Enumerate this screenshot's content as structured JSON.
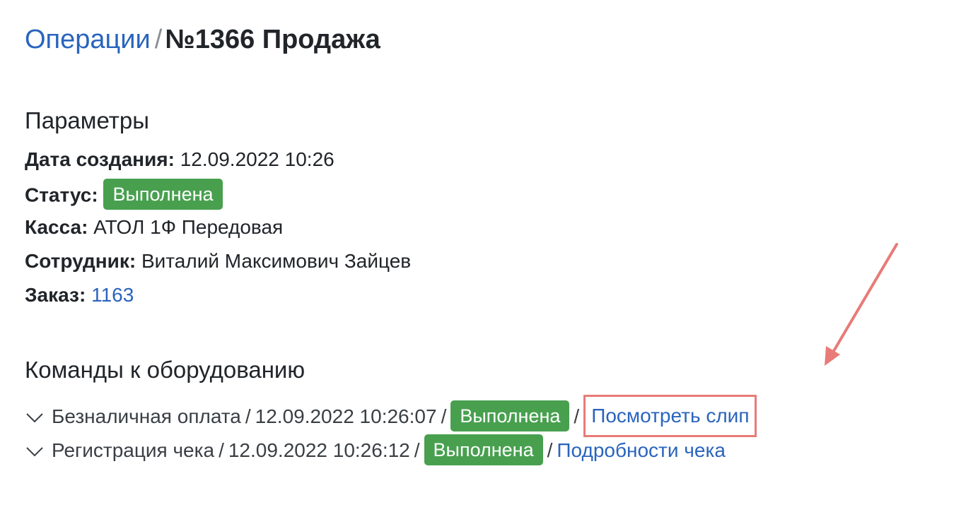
{
  "breadcrumb": {
    "parent": "Операции",
    "separator": "/",
    "current": "№1366 Продажа"
  },
  "params": {
    "title": "Параметры",
    "created_label": "Дата создания:",
    "created_value": "12.09.2022 10:26",
    "status_label": "Статус:",
    "status_value": "Выполнена",
    "kassa_label": "Касса:",
    "kassa_value": "АТОЛ 1Ф Передовая",
    "employee_label": "Сотрудник:",
    "employee_value": "Виталий Максимович Зайцев",
    "order_label": "Заказ:",
    "order_value": "1163"
  },
  "commands": {
    "title": "Команды к оборудованию",
    "items": [
      {
        "name": "Безналичная оплата",
        "datetime": "12.09.2022 10:26:07",
        "status": "Выполнена",
        "link": "Посмотреть слип"
      },
      {
        "name": "Регистрация чека",
        "datetime": "12.09.2022 10:26:12",
        "status": "Выполнена",
        "link": "Подробности чека"
      }
    ],
    "separator": "/"
  },
  "colors": {
    "link": "#2a64bd",
    "success_badge": "#48a04f",
    "annotation": "#e87b78"
  },
  "icons": {
    "expand": "chevron-down-icon"
  }
}
